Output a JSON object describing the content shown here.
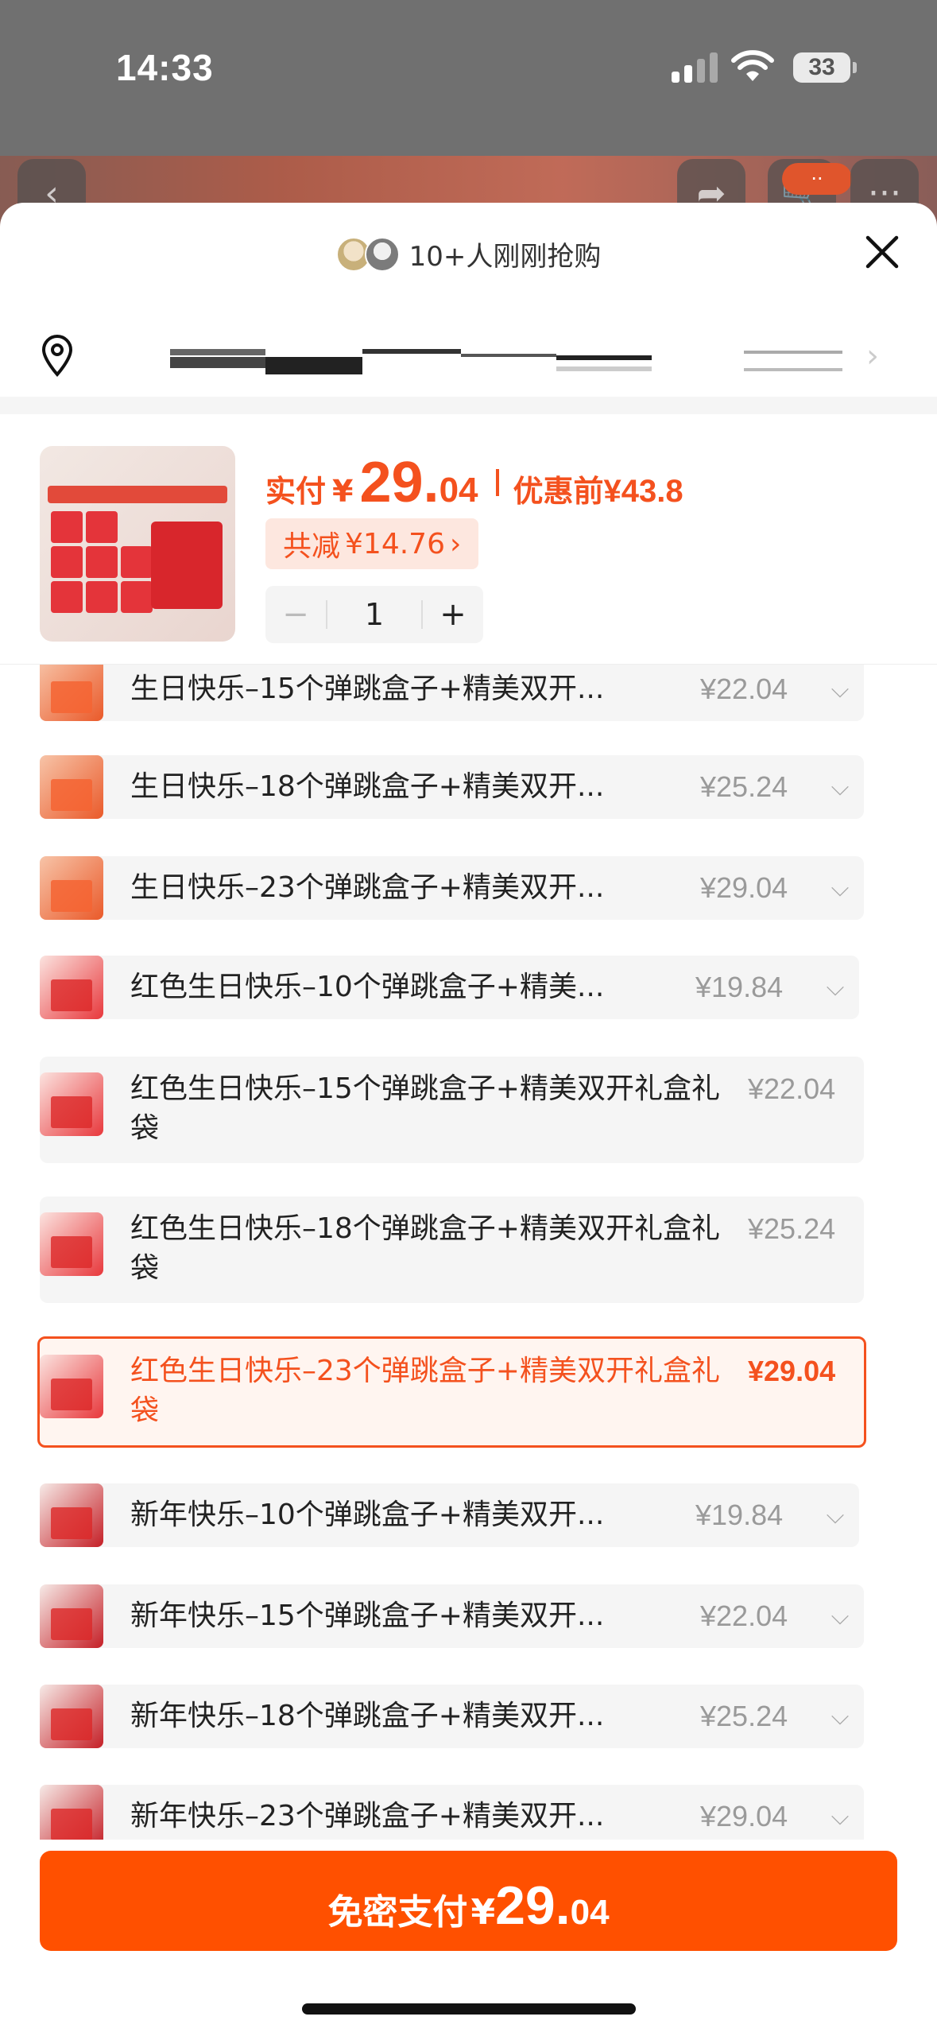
{
  "status_bar": {
    "time": "14:33",
    "battery": "33"
  },
  "header": {
    "buyers_text": "10+人刚刚抢购"
  },
  "product": {
    "price_label": "实付",
    "currency": "¥",
    "price_int": "29.",
    "price_dec": "04",
    "original_label": "优惠前",
    "original_price": "¥43.8",
    "saving_label": "共减",
    "saving_amount": "¥14.76",
    "saving_chevron": "›",
    "quantity": "1",
    "minus": "−",
    "plus": "+"
  },
  "variants": [
    {
      "name": "生日快乐–15个弹跳盒子+精美双开...",
      "price": "¥22.04"
    },
    {
      "name": "生日快乐–18个弹跳盒子+精美双开...",
      "price": "¥25.24"
    },
    {
      "name": "生日快乐–23个弹跳盒子+精美双开...",
      "price": "¥29.04"
    },
    {
      "name": "红色生日快乐–10个弹跳盒子+精美...",
      "price": "¥19.84"
    },
    {
      "name": "红色生日快乐–15个弹跳盒子+精美双开礼盒礼袋",
      "price": "¥22.04"
    },
    {
      "name": "红色生日快乐–18个弹跳盒子+精美双开礼盒礼袋",
      "price": "¥25.24"
    },
    {
      "name": "红色生日快乐–23个弹跳盒子+精美双开礼盒礼袋",
      "price": "¥29.04",
      "selected": true
    },
    {
      "name": "新年快乐–10个弹跳盒子+精美双开...",
      "price": "¥19.84"
    },
    {
      "name": "新年快乐–15个弹跳盒子+精美双开...",
      "price": "¥22.04"
    },
    {
      "name": "新年快乐–18个弹跳盒子+精美双开...",
      "price": "¥25.24"
    },
    {
      "name": "新年快乐–23个弹跳盒子+精美双开...",
      "price": "¥29.04"
    }
  ],
  "pay_button": {
    "label": "免密支付",
    "currency": "¥",
    "int": "29.",
    "dec": "04"
  },
  "colors": {
    "accent": "#ff5000",
    "accent_text": "#f4511e",
    "saving_bg": "#fde7df"
  },
  "icons": [
    "back-icon",
    "share-icon",
    "cart-icon",
    "more-icon",
    "close-icon",
    "location-icon",
    "chevron-right-icon",
    "chevron-down-icon"
  ]
}
